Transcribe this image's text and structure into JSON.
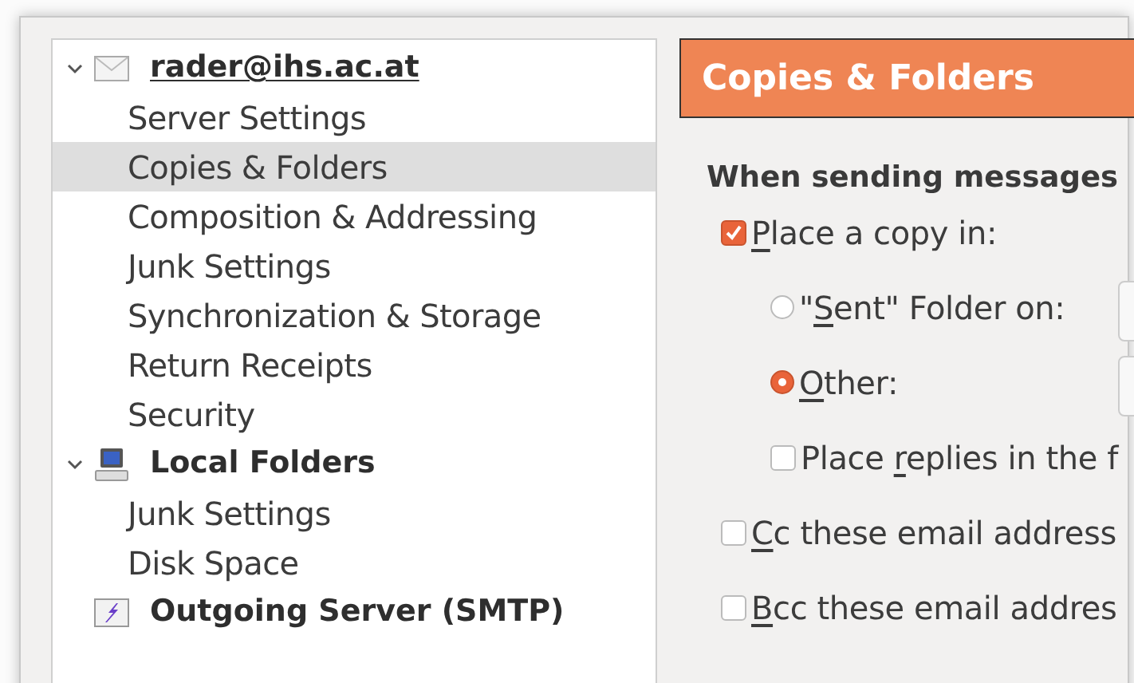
{
  "account_tree": [
    {
      "label": "rader@ihs.ac.at",
      "kind": "mail",
      "expanded": true,
      "focused": true,
      "children": [
        {
          "label": "Server Settings",
          "selected": false
        },
        {
          "label": "Copies & Folders",
          "selected": true
        },
        {
          "label": "Composition & Addressing",
          "selected": false
        },
        {
          "label": "Junk Settings",
          "selected": false
        },
        {
          "label": "Synchronization & Storage",
          "selected": false
        },
        {
          "label": "Return Receipts",
          "selected": false
        },
        {
          "label": "Security",
          "selected": false
        }
      ]
    },
    {
      "label": "Local Folders",
      "kind": "local",
      "expanded": true,
      "focused": false,
      "children": [
        {
          "label": "Junk Settings",
          "selected": false
        },
        {
          "label": "Disk Space",
          "selected": false
        }
      ]
    },
    {
      "label": "Outgoing Server (SMTP)",
      "kind": "smtp",
      "focused": false
    }
  ],
  "page_header": {
    "title": "Copies & Folders"
  },
  "section": {
    "heading": "When sending messages",
    "options": [
      {
        "kind": "checkbox",
        "label_parts": [
          {
            "text": "P",
            "underlined": true
          },
          {
            "text": "lace a copy in:",
            "underlined": false
          }
        ],
        "checked": true,
        "children": [
          {
            "kind": "radio",
            "label_parts": [
              {
                "text": "\"",
                "underlined": false
              },
              {
                "text": "S",
                "underlined": true
              },
              {
                "text": "ent\" Folder on:",
                "underlined": false
              }
            ],
            "checked": false,
            "field": {
              "kind": "dropdown"
            }
          },
          {
            "kind": "radio",
            "label_parts": [
              {
                "text": "O",
                "underlined": true
              },
              {
                "text": "ther:",
                "underlined": false
              }
            ],
            "checked": true,
            "field": {
              "kind": "dropdown"
            }
          },
          {
            "kind": "checkbox",
            "label_parts": [
              {
                "text": "Place ",
                "underlined": false
              },
              {
                "text": "r",
                "underlined": true
              },
              {
                "text": "eplies in the f",
                "underlined": false
              }
            ],
            "checked": false
          }
        ]
      },
      {
        "kind": "checkbox",
        "label_parts": [
          {
            "text": "C",
            "underlined": true
          },
          {
            "text": "c these email address",
            "underlined": false
          }
        ],
        "checked": false
      },
      {
        "kind": "checkbox",
        "label_parts": [
          {
            "text": "B",
            "underlined": true
          },
          {
            "text": "cc these email addres",
            "underlined": false
          }
        ],
        "checked": false
      }
    ]
  }
}
